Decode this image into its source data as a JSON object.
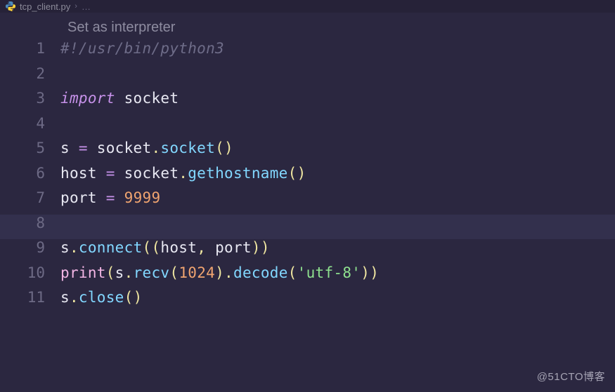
{
  "breadcrumb": {
    "icon": "python-icon",
    "filename": "tcp_client.py",
    "chevron": "›",
    "dots": "…"
  },
  "hint": "Set as interpreter",
  "lines": [
    {
      "n": "1",
      "tokens": [
        {
          "t": "#!/usr/bin/python3",
          "c": "tok-comment"
        }
      ]
    },
    {
      "n": "2",
      "tokens": []
    },
    {
      "n": "3",
      "tokens": [
        {
          "t": "import",
          "c": "tok-keyword"
        },
        {
          "t": " socket",
          "c": "tok-default"
        }
      ]
    },
    {
      "n": "4",
      "tokens": []
    },
    {
      "n": "5",
      "tokens": [
        {
          "t": "s ",
          "c": "tok-default"
        },
        {
          "t": "=",
          "c": "tok-operator"
        },
        {
          "t": " socket",
          "c": "tok-default"
        },
        {
          "t": ".",
          "c": "tok-punct"
        },
        {
          "t": "socket",
          "c": "tok-func"
        },
        {
          "t": "(",
          "c": "tok-paren"
        },
        {
          "t": ")",
          "c": "tok-paren"
        }
      ]
    },
    {
      "n": "6",
      "tokens": [
        {
          "t": "host ",
          "c": "tok-default"
        },
        {
          "t": "=",
          "c": "tok-operator"
        },
        {
          "t": " socket",
          "c": "tok-default"
        },
        {
          "t": ".",
          "c": "tok-punct"
        },
        {
          "t": "gethostname",
          "c": "tok-func"
        },
        {
          "t": "(",
          "c": "tok-paren"
        },
        {
          "t": ")",
          "c": "tok-paren"
        }
      ]
    },
    {
      "n": "7",
      "tokens": [
        {
          "t": "port ",
          "c": "tok-default"
        },
        {
          "t": "=",
          "c": "tok-operator"
        },
        {
          "t": " ",
          "c": "tok-default"
        },
        {
          "t": "9999",
          "c": "tok-number"
        }
      ]
    },
    {
      "n": "8",
      "tokens": [],
      "highlight": true
    },
    {
      "n": "9",
      "tokens": [
        {
          "t": "s",
          "c": "tok-default"
        },
        {
          "t": ".",
          "c": "tok-punct"
        },
        {
          "t": "connect",
          "c": "tok-func"
        },
        {
          "t": "(",
          "c": "tok-paren"
        },
        {
          "t": "(",
          "c": "tok-paren"
        },
        {
          "t": "host",
          "c": "tok-default"
        },
        {
          "t": ",",
          "c": "tok-punct"
        },
        {
          "t": " port",
          "c": "tok-default"
        },
        {
          "t": ")",
          "c": "tok-paren"
        },
        {
          "t": ")",
          "c": "tok-paren"
        }
      ]
    },
    {
      "n": "10",
      "tokens": [
        {
          "t": "print",
          "c": "tok-builtin"
        },
        {
          "t": "(",
          "c": "tok-paren"
        },
        {
          "t": "s",
          "c": "tok-default"
        },
        {
          "t": ".",
          "c": "tok-punct"
        },
        {
          "t": "recv",
          "c": "tok-func"
        },
        {
          "t": "(",
          "c": "tok-paren"
        },
        {
          "t": "1024",
          "c": "tok-number"
        },
        {
          "t": ")",
          "c": "tok-paren"
        },
        {
          "t": ".",
          "c": "tok-punct"
        },
        {
          "t": "decode",
          "c": "tok-func"
        },
        {
          "t": "(",
          "c": "tok-paren"
        },
        {
          "t": "'utf-8'",
          "c": "tok-string"
        },
        {
          "t": ")",
          "c": "tok-paren"
        },
        {
          "t": ")",
          "c": "tok-paren"
        }
      ]
    },
    {
      "n": "11",
      "tokens": [
        {
          "t": "s",
          "c": "tok-default"
        },
        {
          "t": ".",
          "c": "tok-punct"
        },
        {
          "t": "close",
          "c": "tok-func"
        },
        {
          "t": "(",
          "c": "tok-paren"
        },
        {
          "t": ")",
          "c": "tok-paren"
        }
      ]
    }
  ],
  "watermark": "@51CTO博客"
}
